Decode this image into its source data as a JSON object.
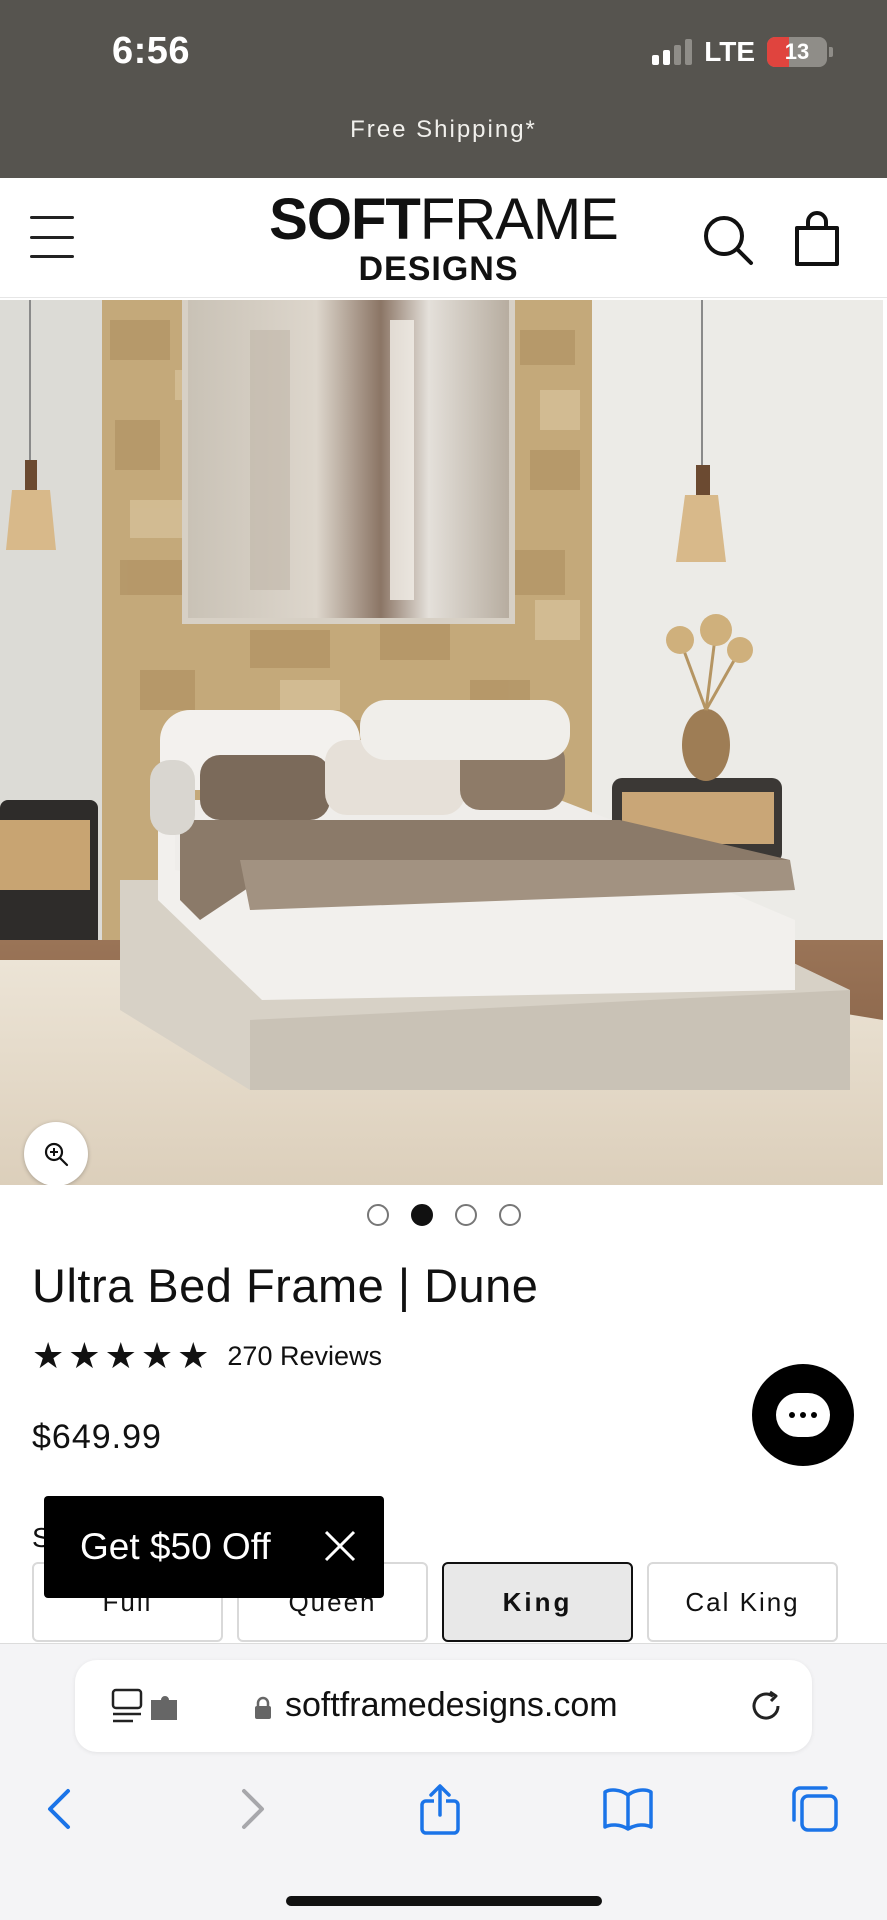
{
  "status_bar": {
    "time": "6:56",
    "network": "LTE",
    "battery": "13"
  },
  "banner": {
    "text": "Free Shipping*"
  },
  "header": {
    "logo_bold": "SOFT",
    "logo_thin": "FRAME",
    "logo_sub": "DESIGNS"
  },
  "gallery": {
    "total_images": 4,
    "active_index": 2
  },
  "product": {
    "title": "Ultra Bed Frame | Dune",
    "rating": 5,
    "reviews": "270 Reviews",
    "price": "$649.99",
    "size_label": "S",
    "sizes": [
      {
        "label": "Full",
        "selected": false
      },
      {
        "label": "Queen",
        "selected": false
      },
      {
        "label": "King",
        "selected": true
      },
      {
        "label": "Cal King",
        "selected": false
      }
    ]
  },
  "promo": {
    "text": "Get $50 Off"
  },
  "browser": {
    "url": "softframedesigns.com"
  },
  "colors": {
    "banner_bg": "#56544f",
    "accent_blue": "#1b74e8",
    "battery_low": "#e0443e"
  }
}
